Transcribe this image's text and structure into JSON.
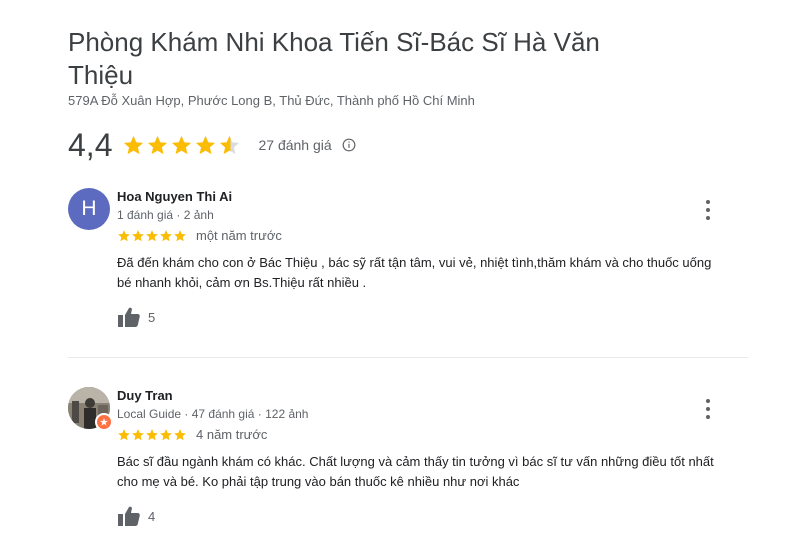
{
  "place": {
    "title": "Phòng Khám Nhi Khoa Tiến Sĩ-Bác Sĩ Hà Văn Thiệu",
    "address": "579A Đỗ Xuân Hợp, Phước Long B, Thủ Đức, Thành phố Hồ Chí Minh",
    "rating": "4,4",
    "review_count": "27 đánh giá",
    "stars_value": 4.4,
    "star_color": "#fbbc04",
    "star_empty_color": "#dadce0"
  },
  "reviews": [
    {
      "avatar_letter": "H",
      "avatar_color": "#5c6bc0",
      "author": "Hoa Nguyen Thi Ai",
      "meta": "1 đánh giá · 2 ảnh",
      "stars": 5,
      "time": "một năm trước",
      "text_line1": "Đã đến khám cho con ở Bác Thiệu , bác sỹ rất tận tâm, vui vẻ, nhiệt tình,thăm khám và cho thuốc uống",
      "text_line2": "bé nhanh khỏi, cảm ơn Bs.Thiệu rất nhiều .",
      "likes": "5"
    },
    {
      "avatar_letter": "",
      "author": "Duy Tran",
      "meta": "Local Guide · 47 đánh giá · 122 ảnh",
      "stars": 5,
      "time": "4 năm trước",
      "text_line1": "Bác sĩ đầu ngành khám có khác. Chất lượng và cảm thấy tin tưởng vì bác sĩ tư vấn những điều tốt nhất",
      "text_line2": "cho mẹ và bé. Ko phải tập trung vào bán thuốc kê nhiều như nơi khác",
      "likes": "4"
    }
  ]
}
